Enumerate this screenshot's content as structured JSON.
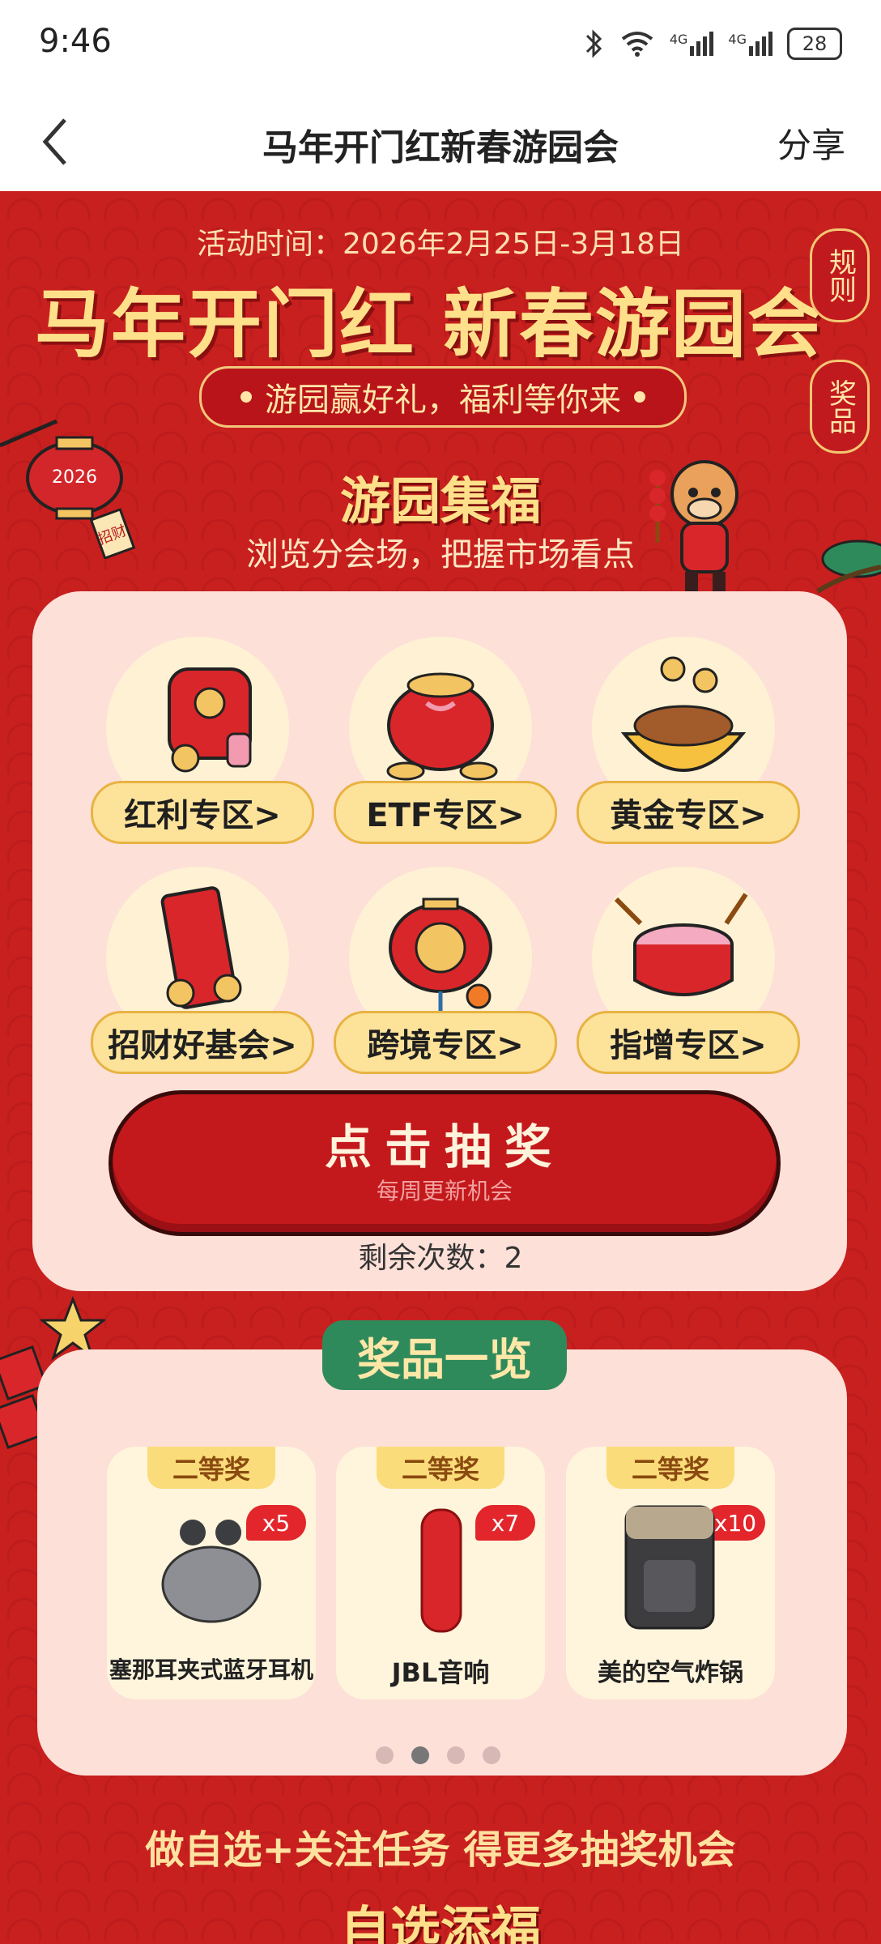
{
  "status": {
    "time": "9:46",
    "battery": "28",
    "net1": "4G",
    "net2": "4G"
  },
  "nav": {
    "title": "马年开门红新春游园会",
    "share": "分享"
  },
  "hero": {
    "activity_time": "活动时间：2026年2月25日-3月18日",
    "title": "马年开门红 新春游园会",
    "slogan": "游园赢好礼，福利等你来",
    "rules_label": "规则",
    "prizes_label": "奖品",
    "lantern_year": "2026",
    "lantern_tag": "招财"
  },
  "section1": {
    "title": "游园集福",
    "subtitle": "浏览分会场，把握市场看点"
  },
  "zones": [
    {
      "label": "红利专区>"
    },
    {
      "label": "ETF专区>"
    },
    {
      "label": "黄金专区>"
    },
    {
      "label": "招财好基会>"
    },
    {
      "label": "跨境专区>"
    },
    {
      "label": "指增专区>"
    }
  ],
  "lottery": {
    "main": "点击抽奖",
    "sub": "每周更新机会",
    "remaining": "剩余次数：2"
  },
  "prizes": {
    "title": "奖品一览",
    "items": [
      {
        "tier": "二等奖",
        "name": "塞那耳夹式蓝牙耳机",
        "count": "x5"
      },
      {
        "tier": "二等奖",
        "name": "JBL音响",
        "count": "x7"
      },
      {
        "tier": "二等奖",
        "name": "美的空气炸锅",
        "count": "x10"
      }
    ],
    "page_count": 4,
    "active_page": 2
  },
  "tasks": {
    "headline": "做自选+关注任务 得更多抽奖机会",
    "section_title": "自选添福"
  },
  "colors": {
    "brand_red": "#c8201f",
    "gold": "#ffe08a",
    "green_tag": "#2f8a5b"
  }
}
